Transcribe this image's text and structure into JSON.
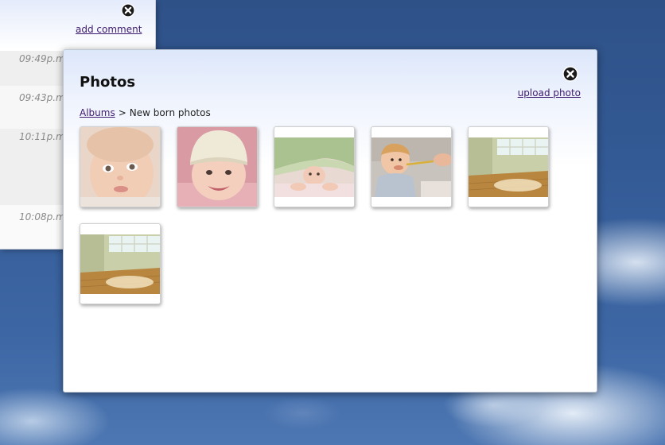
{
  "comments_panel": {
    "add_comment": "add comment",
    "times": [
      "09:49p.m",
      "09:43p.m",
      "10:11p.m",
      "10:08p.m"
    ]
  },
  "dialog": {
    "title": "Photos",
    "upload_label": "upload photo",
    "breadcrumb": {
      "root": "Albums",
      "separator": ">",
      "current": "New born photos"
    }
  },
  "photos": [
    {
      "subject": "baby face close-up"
    },
    {
      "subject": "smiling baby in knit hat"
    },
    {
      "subject": "baby under green blanket"
    },
    {
      "subject": "baby being spoon fed"
    },
    {
      "subject": "empty room with window"
    },
    {
      "subject": "empty room with window"
    }
  ],
  "colors": {
    "link": "#3c1a6e",
    "sky": "#345b96",
    "dialog_header_tint": "#dde7fb"
  },
  "icons": {
    "close": "close-icon"
  }
}
